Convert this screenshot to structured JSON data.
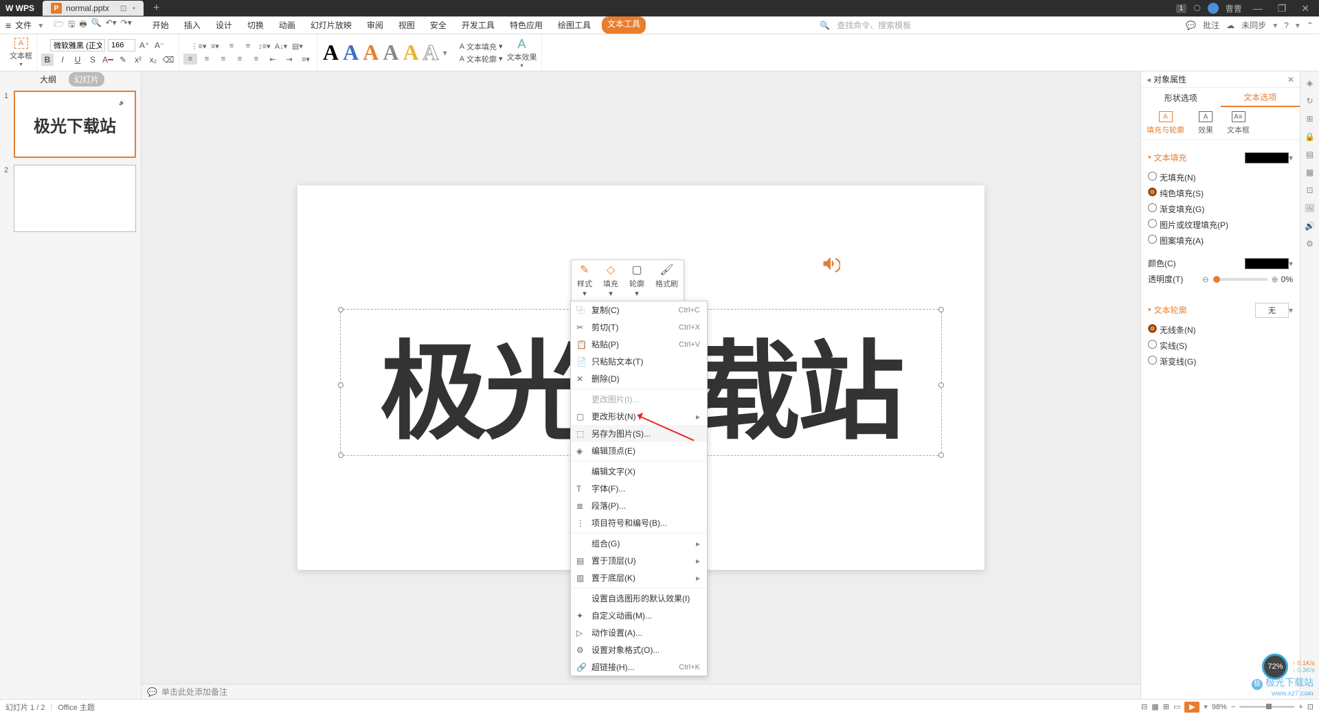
{
  "titlebar": {
    "app": "WPS",
    "tab_name": "normal.pptx",
    "badge": "1",
    "user": "曹曹"
  },
  "menubar": {
    "file": "文件",
    "tabs": [
      "开始",
      "插入",
      "设计",
      "切换",
      "动画",
      "幻灯片放映",
      "审阅",
      "视图",
      "安全",
      "开发工具",
      "特色应用",
      "绘图工具",
      "文本工具"
    ],
    "active_tab": "文本工具",
    "search_placeholder": "查找命令、搜索模板",
    "right": {
      "pizhu": "批注",
      "sync": "未同步"
    }
  },
  "ribbon": {
    "textbox": "文本框",
    "font_name": "微软雅黑 (正文",
    "font_size": "166",
    "wa_chars": [
      "A",
      "A",
      "A",
      "A",
      "A",
      "A"
    ],
    "text_fill": "文本填充",
    "text_outline": "文本轮廓",
    "text_effect": "文本效果"
  },
  "left": {
    "tab_outline": "大纲",
    "tab_slides": "幻灯片",
    "slide1_text": "极光下载站"
  },
  "canvas": {
    "main_text": "极光下载站",
    "notes_placeholder": "单击此处添加备注"
  },
  "mini_toolbar": {
    "items": [
      "样式",
      "填充",
      "轮廓",
      "格式刷"
    ]
  },
  "context_menu": {
    "items": [
      {
        "label": "复制(C)",
        "shortcut": "Ctrl+C",
        "icon": "⿻"
      },
      {
        "label": "剪切(T)",
        "shortcut": "Ctrl+X",
        "icon": "✂"
      },
      {
        "label": "粘贴(P)",
        "shortcut": "Ctrl+V",
        "icon": "📋"
      },
      {
        "label": "只粘贴文本(T)",
        "icon": "📄"
      },
      {
        "label": "删除(D)",
        "icon": "✕"
      },
      {
        "sep": true
      },
      {
        "label": "更改图片(I)...",
        "disabled": true
      },
      {
        "label": "更改形状(N)",
        "sub": true,
        "icon": "▢"
      },
      {
        "label": "另存为图片(S)...",
        "icon": "⬚",
        "hl": true
      },
      {
        "label": "编辑顶点(E)",
        "icon": "◈"
      },
      {
        "sep": true
      },
      {
        "label": "编辑文字(X)"
      },
      {
        "label": "字体(F)...",
        "icon": "T"
      },
      {
        "label": "段落(P)...",
        "icon": "≣"
      },
      {
        "label": "项目符号和编号(B)...",
        "icon": "⋮"
      },
      {
        "sep": true
      },
      {
        "label": "组合(G)",
        "sub": true
      },
      {
        "label": "置于顶层(U)",
        "sub": true,
        "icon": "▤"
      },
      {
        "label": "置于底层(K)",
        "sub": true,
        "icon": "▥"
      },
      {
        "sep": true
      },
      {
        "label": "设置自选图形的默认效果(I)"
      },
      {
        "label": "自定义动画(M)...",
        "icon": "✦"
      },
      {
        "label": "动作设置(A)...",
        "icon": "▷"
      },
      {
        "label": "设置对象格式(O)...",
        "icon": "⚙"
      },
      {
        "label": "超链接(H)...",
        "shortcut": "Ctrl+K",
        "icon": "🔗"
      }
    ]
  },
  "right_panel": {
    "title": "对象属性",
    "tab_shape": "形状选项",
    "tab_text": "文本选项",
    "sub_fill": "填充与轮廓",
    "sub_effect": "效果",
    "sub_textbox": "文本框",
    "sec_fill": "文本填充",
    "fill_options": [
      "无填充(N)",
      "纯色填充(S)",
      "渐变填充(G)",
      "图片或纹理填充(P)",
      "图案填充(A)"
    ],
    "color_label": "颜色(C)",
    "trans_label": "透明度(T)",
    "trans_value": "0%",
    "sec_outline": "文本轮廓",
    "outline_options": [
      "无线条(N)",
      "实线(S)",
      "渐变线(G)"
    ],
    "outline_value": "无"
  },
  "status": {
    "slide_info": "幻灯片 1 / 2",
    "theme": "Office 主题",
    "zoom": "98%"
  },
  "perf": {
    "percent": "72%",
    "up": "0.1K/s",
    "down": "0.3K/s"
  },
  "watermark": {
    "text": "极光下载站",
    "url": "www.xz7.com"
  }
}
